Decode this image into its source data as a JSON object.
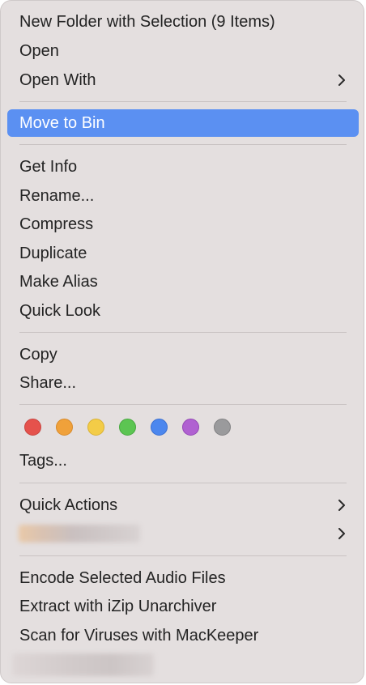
{
  "menu": {
    "items": [
      {
        "label": "New Folder with Selection (9 Items)"
      },
      {
        "label": "Open"
      },
      {
        "label": "Open With"
      },
      {
        "label": "Move to Bin"
      },
      {
        "label": "Get Info"
      },
      {
        "label": "Rename..."
      },
      {
        "label": "Compress"
      },
      {
        "label": "Duplicate"
      },
      {
        "label": "Make Alias"
      },
      {
        "label": "Quick Look"
      },
      {
        "label": "Copy"
      },
      {
        "label": "Share..."
      },
      {
        "label": "Tags..."
      },
      {
        "label": "Quick Actions"
      },
      {
        "label": "Encode Selected Audio Files"
      },
      {
        "label": "Extract with iZip Unarchiver"
      },
      {
        "label": "Scan for Viruses with MacKeeper"
      }
    ],
    "highlight_color": "#5b90f2",
    "tags": [
      {
        "color": "#e5524c",
        "border": "#c84540"
      },
      {
        "color": "#f0a13a",
        "border": "#d88a2a"
      },
      {
        "color": "#f3cc47",
        "border": "#d9b235"
      },
      {
        "color": "#5cc552",
        "border": "#47a83f"
      },
      {
        "color": "#4c87ee",
        "border": "#3a6fd0"
      },
      {
        "color": "#b061d1",
        "border": "#9449b5"
      },
      {
        "color": "#9a9a9c",
        "border": "#808082"
      }
    ]
  }
}
